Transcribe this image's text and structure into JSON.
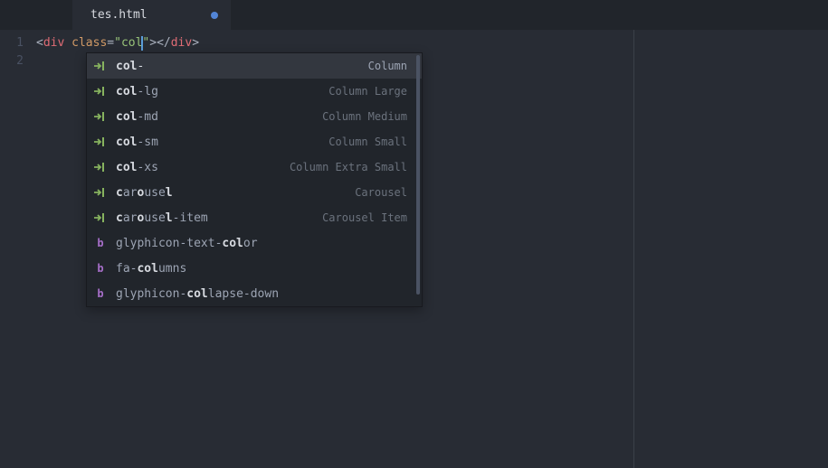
{
  "tab": {
    "title": "tes.html",
    "modified": true
  },
  "lineNumbers": [
    "1",
    "2"
  ],
  "code": {
    "openBracket": "<",
    "tagOpen": "div",
    "space": " ",
    "attrName": "class",
    "eq": "=",
    "q1": "\"",
    "attrValue": "col",
    "q2": "\"",
    "closeBracket": ">",
    "openBracket2": "</",
    "tagClose": "div",
    "closeBracket2": ">"
  },
  "autocomplete": {
    "items": [
      {
        "icon": "snippet",
        "labelParts": [
          "<b>col</b>-"
        ],
        "desc": "Column",
        "selected": true
      },
      {
        "icon": "snippet",
        "labelParts": [
          "<b>col</b>-lg"
        ],
        "desc": "Column Large"
      },
      {
        "icon": "snippet",
        "labelParts": [
          "<b>col</b>-md"
        ],
        "desc": "Column Medium"
      },
      {
        "icon": "snippet",
        "labelParts": [
          "<b>col</b>-sm"
        ],
        "desc": "Column Small"
      },
      {
        "icon": "snippet",
        "labelParts": [
          "<b>col</b>-xs"
        ],
        "desc": "Column Extra Small"
      },
      {
        "icon": "snippet",
        "labelParts": [
          "<b>c</b>ar<b>o</b>use<b>l</b>"
        ],
        "desc": "Carousel"
      },
      {
        "icon": "snippet",
        "labelParts": [
          "<b>c</b>ar<b>o</b>use<b>l</b>-item"
        ],
        "desc": "Carousel Item"
      },
      {
        "icon": "bclass",
        "labelParts": [
          "glyphicon-text-<b>col</b>or"
        ],
        "desc": ""
      },
      {
        "icon": "bclass",
        "labelParts": [
          "fa-<b>col</b>umns"
        ],
        "desc": ""
      },
      {
        "icon": "bclass",
        "labelParts": [
          "glyphicon-<b>col</b>lapse-down"
        ],
        "desc": ""
      }
    ]
  }
}
